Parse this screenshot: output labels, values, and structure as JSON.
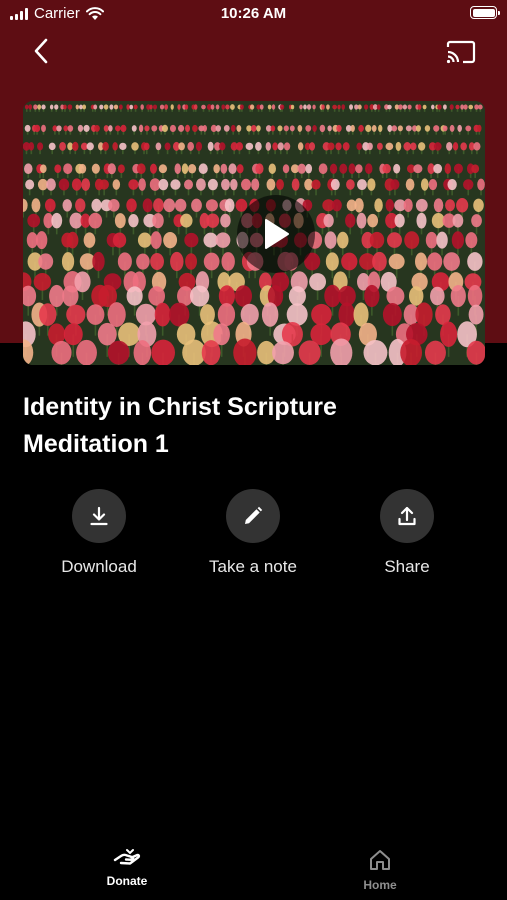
{
  "status_bar": {
    "carrier": "Carrier",
    "time": "10:26 AM"
  },
  "nav": {
    "back_icon": "chevron-left-icon",
    "cast_icon": "cast-icon"
  },
  "hero": {
    "play_icon": "play-icon"
  },
  "title": "Identity in Christ Scripture Meditation 1",
  "actions": [
    {
      "label": "Download",
      "icon": "download-icon"
    },
    {
      "label": "Take a note",
      "icon": "pencil-icon"
    },
    {
      "label": "Share",
      "icon": "share-icon"
    }
  ],
  "tabs": [
    {
      "label": "Donate",
      "icon": "donate-icon",
      "active": true
    },
    {
      "label": "Home",
      "icon": "home-icon",
      "active": false
    }
  ],
  "colors": {
    "header_background": "#5e0d13",
    "page_background": "#000000",
    "action_circle": "#333333",
    "tab_active": "#ffffff",
    "tab_inactive": "#8e8e8e"
  }
}
